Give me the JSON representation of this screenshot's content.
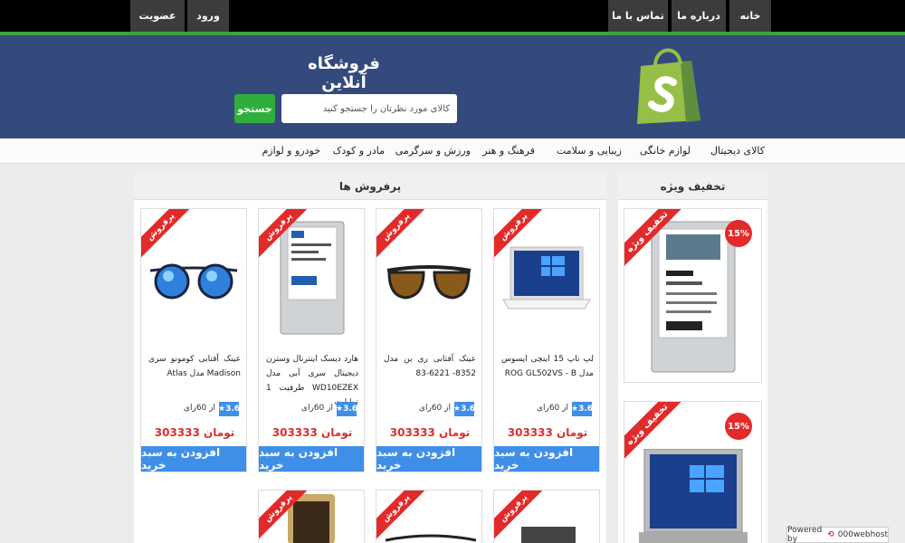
{
  "top_nav": {
    "right": [
      "خانه",
      "درباره ما",
      "تماس با ما"
    ],
    "left": [
      "ورود",
      "عضویت"
    ]
  },
  "header": {
    "title": "فروشگاه آنلاین",
    "search_placeholder": "کالای مورد نظرتان را جستجو کنید",
    "search_button": "جستجو"
  },
  "categories": [
    "کالای دیجیتال",
    "لوازم خانگی",
    "زیبایی و سلامت",
    "فرهنگ و هنر",
    "ورزش و سرگرمی",
    "مادر و کودک",
    "خودرو و لوازم"
  ],
  "bestsellers": {
    "title": "پرفروش ها",
    "ribbon": "پرفروش",
    "products": [
      {
        "name": "لپ تاپ 15 اینچی ایسوس مدل ROG GL502VS - B",
        "rating": "3.6",
        "rating_text": "از 60رای",
        "price": "303333 تومان",
        "button": "افزودن به سبد خرید"
      },
      {
        "name": "عینک آفتابی ری بن مدل 8352- 6221-83",
        "rating": "3.6",
        "rating_text": "از 60رای",
        "price": "303333 تومان",
        "button": "افزودن به سبد خرید"
      },
      {
        "name": "هارد دیسک اینترنال وسترن دیجیتال سری آبی مدل WD10EZEX ظرفیت 1 ترابایت",
        "rating": "3.6",
        "rating_text": "از 60رای",
        "price": "303333 تومان",
        "button": "افزودن به سبد خرید"
      },
      {
        "name": "عینک آفتابی کومونو سری Madison مدل Atlas",
        "rating": "3.6",
        "rating_text": "از 60رای",
        "price": "303333 تومان",
        "button": "افزودن به سبد خرید"
      }
    ]
  },
  "special": {
    "title": "تخفیف ویژه",
    "ribbon": "تخفیف ویژه",
    "items": [
      {
        "discount": "15%"
      },
      {
        "discount": "15%"
      }
    ]
  },
  "hosted": {
    "prefix": "Powered by",
    "brand": "000webhost"
  },
  "colors": {
    "header_bg": "#34497c",
    "accent_green": "#3aa33a",
    "button_blue": "#3f8fe8",
    "price_red": "#d9302f"
  }
}
